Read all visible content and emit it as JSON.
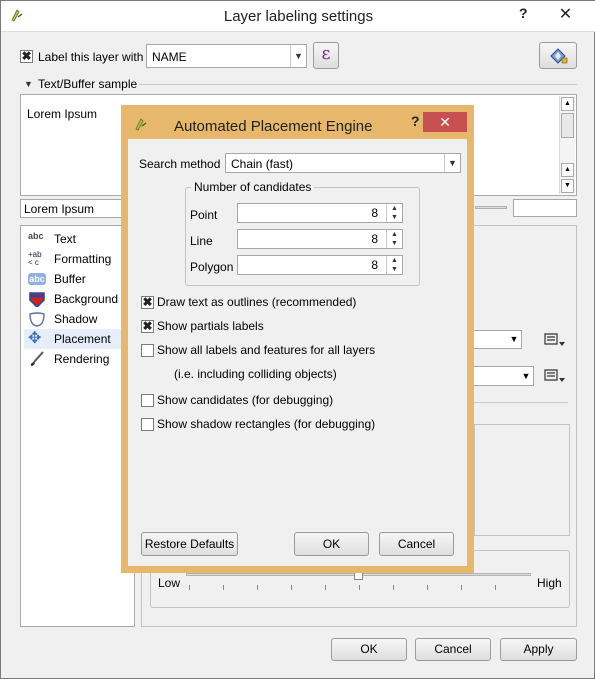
{
  "window": {
    "title": "Layer labeling settings",
    "help": "?",
    "close": "✕"
  },
  "top": {
    "label_layer_checkbox": "✖",
    "label_layer_text": "Label this layer with",
    "field_value": "NAME",
    "expression_button": "ε"
  },
  "sample": {
    "header": "Text/Buffer sample",
    "preview_text": "Lorem Ipsum",
    "input_value": "Lorem Ipsum"
  },
  "sidebar": {
    "items": [
      {
        "label": "Text",
        "icon": "text-abc-icon",
        "glyph": "abc"
      },
      {
        "label": "Formatting",
        "icon": "formatting-icon",
        "glyph": "+ab\n< c"
      },
      {
        "label": "Buffer",
        "icon": "buffer-icon",
        "glyph": "abc"
      },
      {
        "label": "Background",
        "icon": "background-shield-icon",
        "glyph": ""
      },
      {
        "label": "Shadow",
        "icon": "shadow-icon",
        "glyph": ""
      },
      {
        "label": "Placement",
        "icon": "placement-icon",
        "glyph": "✥"
      },
      {
        "label": "Rendering",
        "icon": "rendering-brush-icon",
        "glyph": "⁄"
      }
    ]
  },
  "slider": {
    "low": "Low",
    "high": "High"
  },
  "footer": {
    "ok": "OK",
    "cancel": "Cancel",
    "apply": "Apply"
  },
  "dialog": {
    "title": "Automated Placement Engine",
    "help": "?",
    "close": "✕",
    "search_method_label": "Search method",
    "search_method_value": "Chain (fast)",
    "candidates_group": "Number of candidates",
    "point_label": "Point",
    "point_value": "8",
    "line_label": "Line",
    "line_value": "8",
    "polygon_label": "Polygon",
    "polygon_value": "8",
    "draw_outlines": "Draw text as outlines (recommended)",
    "draw_outlines_checked": "✖",
    "show_partials": "Show partials labels",
    "show_partials_checked": "✖",
    "show_all": "Show all labels and features for all layers",
    "show_all_note": "(i.e. including colliding objects)",
    "show_candidates": "Show candidates (for debugging)",
    "show_shadow_rects": "Show shadow rectangles (for debugging)",
    "restore_defaults": "Restore Defaults",
    "ok": "OK",
    "cancel": "Cancel"
  },
  "colors": {
    "dialog_frame": "#e7b86b",
    "close_red": "#c75050",
    "selected_row": "#e5eef9"
  }
}
